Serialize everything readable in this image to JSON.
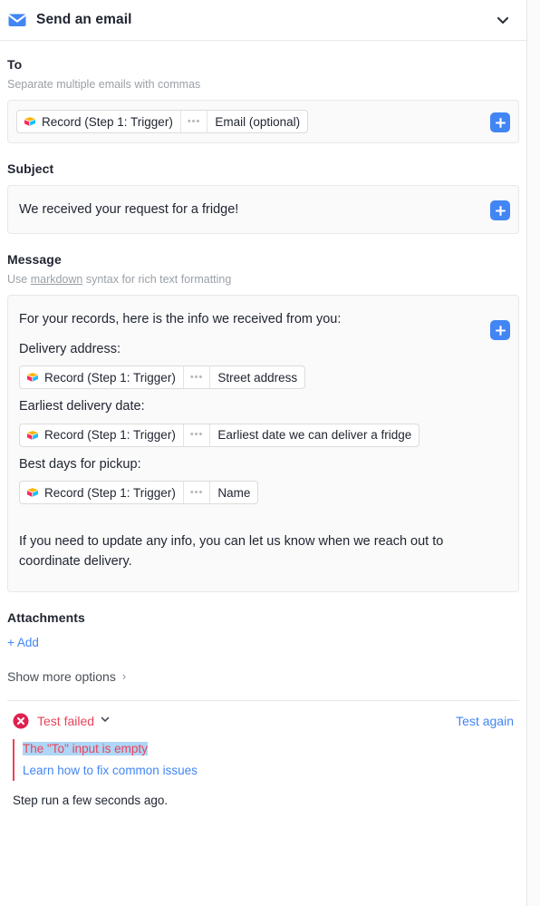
{
  "header": {
    "title": "Send an email",
    "icon": "envelope-icon",
    "collapse_icon": "chevron-down-icon"
  },
  "colors": {
    "accent_blue": "#4285f4",
    "error_red": "#ea4359",
    "selection_highlight": "#add6f7",
    "field_bg": "#fafafa",
    "border": "#e8e8e8"
  },
  "to": {
    "label": "To",
    "hint": "Separate multiple emails with commas",
    "token": {
      "source": "Record (Step 1: Trigger)",
      "separator": "•••",
      "field": "Email (optional)",
      "icon": "airtable-record-icon"
    },
    "insert_button": "+"
  },
  "subject": {
    "label": "Subject",
    "value": "We received your request for a fridge!",
    "insert_button": "+"
  },
  "message": {
    "label": "Message",
    "hint_prefix": "Use ",
    "hint_link": "markdown",
    "hint_suffix": " syntax for rich text formatting",
    "insert_button": "+",
    "intro": "For your records, here is the info we received from you:",
    "rows": [
      {
        "label": "Delivery address:",
        "token": {
          "source": "Record (Step 1: Trigger)",
          "separator": "•••",
          "field": "Street address",
          "icon": "airtable-record-icon"
        }
      },
      {
        "label": "Earliest delivery date:",
        "token": {
          "source": "Record (Step 1: Trigger)",
          "separator": "•••",
          "field": "Earliest date we can deliver a fridge",
          "icon": "airtable-record-icon"
        }
      },
      {
        "label": "Best days for pickup:",
        "token": {
          "source": "Record (Step 1: Trigger)",
          "separator": "•••",
          "field": "Name",
          "icon": "airtable-record-icon"
        }
      }
    ],
    "outro": "If you need to update any info, you can let us know when we reach out to coordinate delivery."
  },
  "attachments": {
    "label": "Attachments",
    "add_label": "+ Add"
  },
  "show_more": {
    "label": "Show more options",
    "caret": "›"
  },
  "test_result": {
    "status": "Test failed",
    "status_icon": "error-circle-icon",
    "status_caret": "chevron-down-icon",
    "test_again": "Test again",
    "error_message": "The \"To\" input is empty",
    "help_link": "Learn how to fix common issues",
    "step_run": "Step run a few seconds ago."
  }
}
